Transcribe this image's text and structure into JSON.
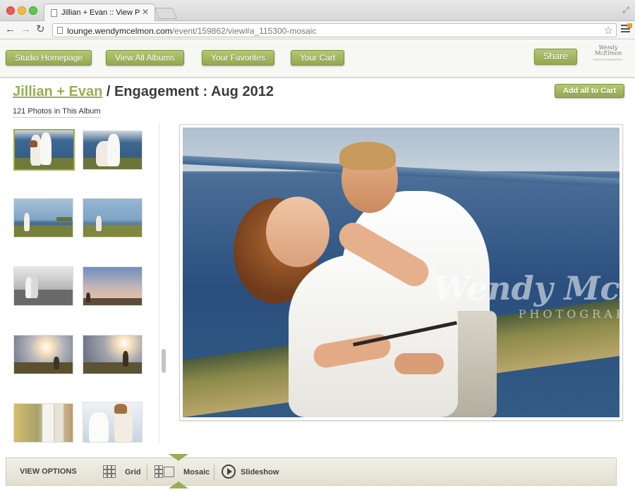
{
  "browser": {
    "tab_title": "Jillian + Evan :: View Photo",
    "url_host": "lounge.wendymcelmon.com",
    "url_path": "/event/159862/view#a_115300-mosaic"
  },
  "nav": {
    "studio_homepage": "Studio Homepage",
    "view_all_albums": "View All Albums",
    "your_favorites": "Your Favorites",
    "your_cart": "Your Cart",
    "share": "Share"
  },
  "logo": {
    "script": "Wendy McElmon",
    "sub": "PHOTOGRAPHY"
  },
  "album": {
    "couple": "Jillian + Evan",
    "rest_title": " / Engagement : Aug 2012",
    "add_all": "Add all to Cart",
    "count": "121 Photos in This Album"
  },
  "watermark": {
    "script": "Wendy McElmon",
    "sub": "PHOTOGRAPHY"
  },
  "view_options": {
    "label": "VIEW OPTIONS",
    "grid": "Grid",
    "mosaic": "Mosaic",
    "slideshow": "Slideshow",
    "selected": "Mosaic"
  },
  "colors": {
    "accent_green": "#98ad55",
    "ocean": "#2a4f7e"
  }
}
